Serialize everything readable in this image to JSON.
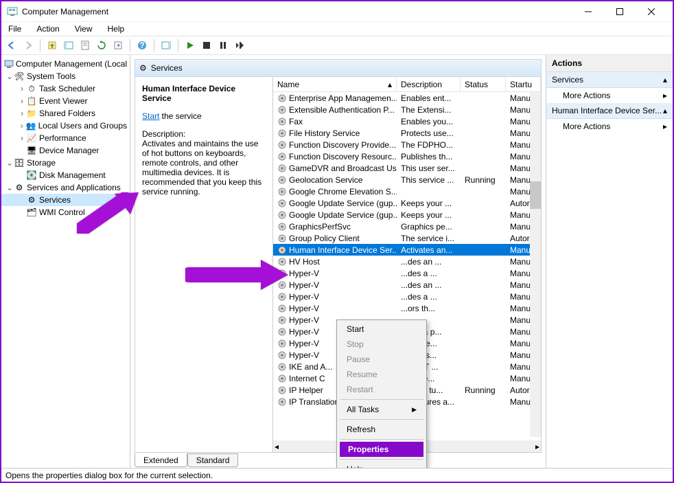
{
  "window": {
    "title": "Computer Management"
  },
  "menu": {
    "file": "File",
    "action": "Action",
    "view": "View",
    "help": "Help"
  },
  "tree": {
    "root": "Computer Management (Local",
    "systools": "System Tools",
    "task": "Task Scheduler",
    "event": "Event Viewer",
    "shared": "Shared Folders",
    "local": "Local Users and Groups",
    "perf": "Performance",
    "devmgr": "Device Manager",
    "storage": "Storage",
    "disk": "Disk Management",
    "svcapp": "Services and Applications",
    "services": "Services",
    "wmi": "WMI Control"
  },
  "svc": {
    "headerTitle": "Services",
    "selectedName": "Human Interface Device Service",
    "startLink": "Start",
    "startRest": " the service",
    "descLabel": "Description:",
    "desc": "Activates and maintains the use of hot buttons on keyboards, remote controls, and other multimedia devices. It is recommended that you keep this service running."
  },
  "cols": {
    "name": "Name",
    "desc": "Description",
    "status": "Status",
    "startup": "Startu"
  },
  "rows": [
    {
      "name": "Enterprise App Managemen...",
      "desc": "Enables ent...",
      "status": "",
      "startup": "Manu"
    },
    {
      "name": "Extensible Authentication P...",
      "desc": "The Extensi...",
      "status": "",
      "startup": "Manu"
    },
    {
      "name": "Fax",
      "desc": "Enables you...",
      "status": "",
      "startup": "Manu"
    },
    {
      "name": "File History Service",
      "desc": "Protects use...",
      "status": "",
      "startup": "Manu"
    },
    {
      "name": "Function Discovery Provide...",
      "desc": "The FDPHO...",
      "status": "",
      "startup": "Manu"
    },
    {
      "name": "Function Discovery Resourc...",
      "desc": "Publishes th...",
      "status": "",
      "startup": "Manu"
    },
    {
      "name": "GameDVR and Broadcast Us...",
      "desc": "This user ser...",
      "status": "",
      "startup": "Manu"
    },
    {
      "name": "Geolocation Service",
      "desc": "This service ...",
      "status": "Running",
      "startup": "Manu"
    },
    {
      "name": "Google Chrome Elevation S...",
      "desc": "",
      "status": "",
      "startup": "Manu"
    },
    {
      "name": "Google Update Service (gup...",
      "desc": "Keeps your ...",
      "status": "",
      "startup": "Autor"
    },
    {
      "name": "Google Update Service (gup...",
      "desc": "Keeps your ...",
      "status": "",
      "startup": "Manu"
    },
    {
      "name": "GraphicsPerfSvc",
      "desc": "Graphics pe...",
      "status": "",
      "startup": "Manu"
    },
    {
      "name": "Group Policy Client",
      "desc": "The service i...",
      "status": "",
      "startup": "Autor"
    },
    {
      "name": "Human Interface Device Ser...",
      "desc": "Activates an...",
      "status": "",
      "startup": "Manu",
      "selected": true
    },
    {
      "name": "HV Host",
      "desc": "...des an ...",
      "status": "",
      "startup": "Manu"
    },
    {
      "name": "Hyper-V",
      "desc": "...des a ...",
      "status": "",
      "startup": "Manu"
    },
    {
      "name": "Hyper-V",
      "desc": "...des an ...",
      "status": "",
      "startup": "Manu"
    },
    {
      "name": "Hyper-V",
      "desc": "...des a ...",
      "status": "",
      "startup": "Manu"
    },
    {
      "name": "Hyper-V",
      "desc": "...ors th...",
      "status": "",
      "startup": "Manu"
    },
    {
      "name": "Hyper-V",
      "desc": "",
      "status": "",
      "startup": "Manu"
    },
    {
      "name": "Hyper-V",
      "desc": "...des a p...",
      "status": "",
      "startup": "Manu"
    },
    {
      "name": "Hyper-V",
      "desc": "...ronize...",
      "status": "",
      "startup": "Manu"
    },
    {
      "name": "Hyper-V",
      "desc": "...inates...",
      "status": "",
      "startup": "Manu"
    },
    {
      "name": "IKE and A...",
      "desc": "...EEXT ...",
      "status": "",
      "startup": "Manu"
    },
    {
      "name": "Internet C",
      "desc": "...es ne...",
      "status": "",
      "startup": "Manu"
    },
    {
      "name": "IP Helper",
      "desc": "...vides tu...",
      "status": "Running",
      "startup": "Autor"
    },
    {
      "name": "IP Translation Configuratio...",
      "desc": "Configures a...",
      "status": "",
      "startup": "Manu"
    }
  ],
  "tabs": {
    "ext": "Extended",
    "std": "Standard"
  },
  "statusbar": "Opens the properties dialog box for the current selection.",
  "actions": {
    "title": "Actions",
    "grp1": "Services",
    "more": "More Actions",
    "grp2": "Human Interface Device Ser..."
  },
  "ctx": {
    "start": "Start",
    "stop": "Stop",
    "pause": "Pause",
    "resume": "Resume",
    "restart": "Restart",
    "alltasks": "All Tasks",
    "refresh": "Refresh",
    "properties": "Properties",
    "help": "Help"
  }
}
